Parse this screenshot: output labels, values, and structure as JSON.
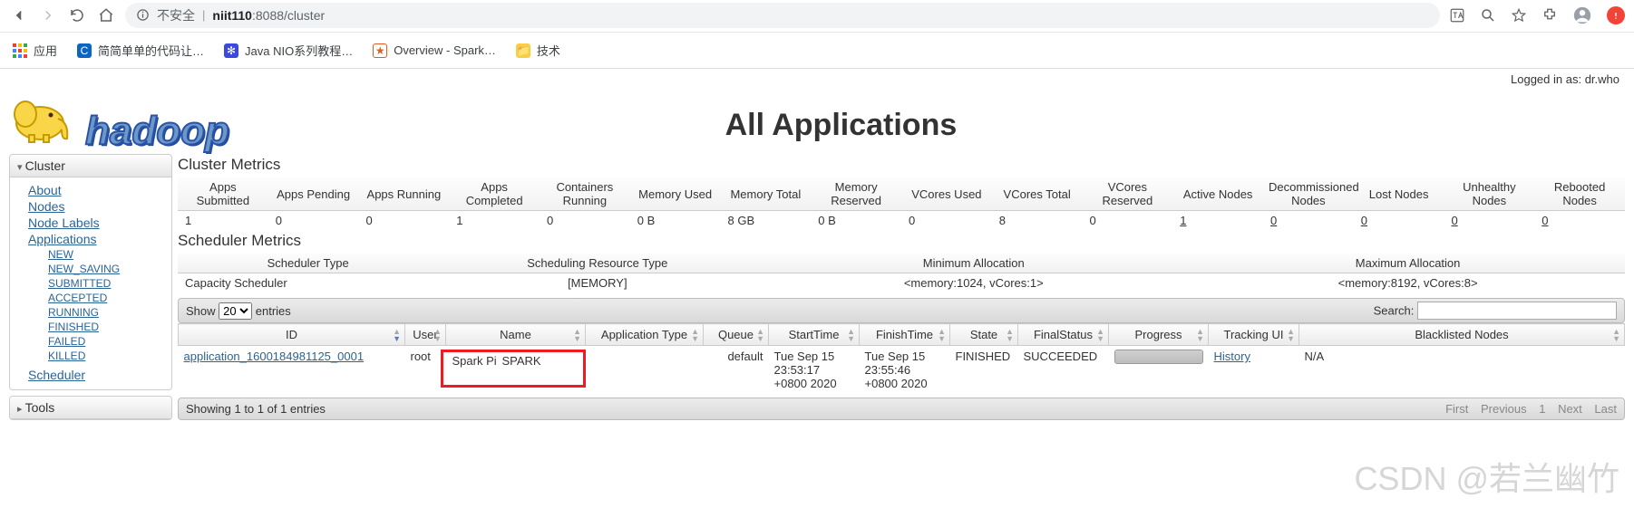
{
  "browser": {
    "security_label": "不安全",
    "url_host": "niit110",
    "url_path": ":8088/cluster",
    "bookmarks": {
      "apps": "应用",
      "b1": "简简单单的代码让…",
      "b2": "Java NIO系列教程…",
      "b3": "Overview - Spark…",
      "b4": "技术"
    }
  },
  "login_prefix": "Logged in as: ",
  "login_user": "dr.who",
  "page_title": "All Applications",
  "sidebar": {
    "cluster_head": "Cluster",
    "about": "About",
    "nodes": "Nodes",
    "node_labels": "Node Labels",
    "applications": "Applications",
    "states": {
      "new": "NEW",
      "new_saving": "NEW_SAVING",
      "submitted": "SUBMITTED",
      "accepted": "ACCEPTED",
      "running": "RUNNING",
      "finished": "FINISHED",
      "failed": "FAILED",
      "killed": "KILLED"
    },
    "scheduler": "Scheduler",
    "tools_head": "Tools"
  },
  "cluster_metrics": {
    "title": "Cluster Metrics",
    "headers": {
      "h1": "Apps Submitted",
      "h2": "Apps Pending",
      "h3": "Apps Running",
      "h4": "Apps Completed",
      "h5": "Containers Running",
      "h6": "Memory Used",
      "h7": "Memory Total",
      "h8": "Memory Reserved",
      "h9": "VCores Used",
      "h10": "VCores Total",
      "h11": "VCores Reserved",
      "h12": "Active Nodes",
      "h13": "Decommissioned Nodes",
      "h14": "Lost Nodes",
      "h15": "Unhealthy Nodes",
      "h16": "Rebooted Nodes"
    },
    "values": {
      "v1": "1",
      "v2": "0",
      "v3": "0",
      "v4": "1",
      "v5": "0",
      "v6": "0 B",
      "v7": "8 GB",
      "v8": "0 B",
      "v9": "0",
      "v10": "8",
      "v11": "0",
      "v12": "1",
      "v13": "0",
      "v14": "0",
      "v15": "0",
      "v16": "0"
    }
  },
  "scheduler_metrics": {
    "title": "Scheduler Metrics",
    "headers": {
      "h1": "Scheduler Type",
      "h2": "Scheduling Resource Type",
      "h3": "Minimum Allocation",
      "h4": "Maximum Allocation"
    },
    "values": {
      "v1": "Capacity Scheduler",
      "v2": "[MEMORY]",
      "v3": "<memory:1024, vCores:1>",
      "v4": "<memory:8192, vCores:8>"
    }
  },
  "datatable": {
    "show_prefix": "Show ",
    "show_value": "20",
    "show_suffix": " entries",
    "search_label": "Search: ",
    "headers": {
      "id": "ID",
      "user": "User",
      "name": "Name",
      "app_type": "Application Type",
      "queue": "Queue",
      "start": "StartTime",
      "finish": "FinishTime",
      "state": "State",
      "fstatus": "FinalStatus",
      "progress": "Progress",
      "tracking": "Tracking UI",
      "blacklist": "Blacklisted Nodes"
    },
    "row": {
      "id": "application_1600184981125_0001",
      "user": "root",
      "name": "Spark Pi",
      "app_type": "SPARK",
      "queue": "default",
      "start": "Tue Sep 15 23:53:17 +0800 2020",
      "finish": "Tue Sep 15 23:55:46 +0800 2020",
      "state": "FINISHED",
      "fstatus": "SUCCEEDED",
      "tracking": "History",
      "blacklist": "N/A"
    },
    "footer_info": "Showing 1 to 1 of 1 entries",
    "pager": {
      "first": "First",
      "prev": "Previous",
      "p1": "1",
      "next": "Next",
      "last": "Last"
    }
  },
  "watermark": "CSDN @若兰幽竹"
}
